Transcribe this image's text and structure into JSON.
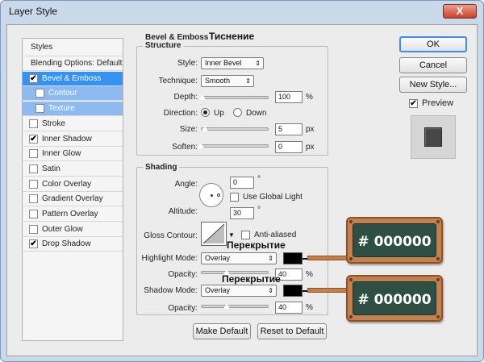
{
  "window": {
    "title": "Layer Style",
    "close": "X"
  },
  "styles_panel": {
    "header": "Styles",
    "items": [
      {
        "label": "Blending Options: Default",
        "checkbox": false,
        "checked": false
      },
      {
        "label": "Bevel & Emboss",
        "checkbox": true,
        "checked": true,
        "selected": true
      },
      {
        "label": "Contour",
        "checkbox": true,
        "checked": false,
        "sub": true
      },
      {
        "label": "Texture",
        "checkbox": true,
        "checked": false,
        "sub": true
      },
      {
        "label": "Stroke",
        "checkbox": true,
        "checked": false
      },
      {
        "label": "Inner Shadow",
        "checkbox": true,
        "checked": true
      },
      {
        "label": "Inner Glow",
        "checkbox": true,
        "checked": false
      },
      {
        "label": "Satin",
        "checkbox": true,
        "checked": false
      },
      {
        "label": "Color Overlay",
        "checkbox": true,
        "checked": false
      },
      {
        "label": "Gradient Overlay",
        "checkbox": true,
        "checked": false
      },
      {
        "label": "Pattern Overlay",
        "checkbox": true,
        "checked": false
      },
      {
        "label": "Outer Glow",
        "checkbox": true,
        "checked": false
      },
      {
        "label": "Drop Shadow",
        "checkbox": true,
        "checked": true
      }
    ],
    "check_mark": "✔"
  },
  "bevel": {
    "title": "Bevel & Emboss",
    "annotation": "Тиснение",
    "structure": {
      "title": "Structure",
      "style_label": "Style:",
      "style_value": "Inner Bevel",
      "technique_label": "Technique:",
      "technique_value": "Smooth",
      "depth_label": "Depth:",
      "depth_value": "100",
      "depth_unit": "%",
      "direction_label": "Direction:",
      "direction_up": "Up",
      "direction_down": "Down",
      "size_label": "Size:",
      "size_value": "5",
      "size_unit": "px",
      "soften_label": "Soften:",
      "soften_value": "0",
      "soften_unit": "px"
    },
    "shading": {
      "title": "Shading",
      "angle_label": "Angle:",
      "angle_value": "0",
      "degree": "°",
      "use_global_light": "Use Global Light",
      "altitude_label": "Altitude:",
      "altitude_value": "30",
      "gloss_contour_label": "Gloss Contour:",
      "anti_aliased": "Anti-aliased",
      "highlight_mode_label": "Highlight Mode:",
      "highlight_mode_value": "Overlay",
      "highlight_opacity_label": "Opacity:",
      "highlight_opacity_value": "40",
      "highlight_opacity_unit": "%",
      "shadow_mode_label": "Shadow Mode:",
      "shadow_mode_value": "Overlay",
      "shadow_opacity_label": "Opacity:",
      "shadow_opacity_value": "40",
      "shadow_opacity_unit": "%",
      "highlight_annotation": "Перекрытие",
      "shadow_annotation": "Перекрытие"
    },
    "make_default": "Make Default",
    "reset_default": "Reset to Default"
  },
  "buttons": {
    "ok": "OK",
    "cancel": "Cancel",
    "new_style": "New Style...",
    "preview": "Preview"
  },
  "boards": {
    "highlight_hex": "# 000000",
    "shadow_hex": "# 000000"
  },
  "colors": {
    "highlight": "#000000",
    "shadow": "#000000",
    "selection": "#3591f2"
  }
}
